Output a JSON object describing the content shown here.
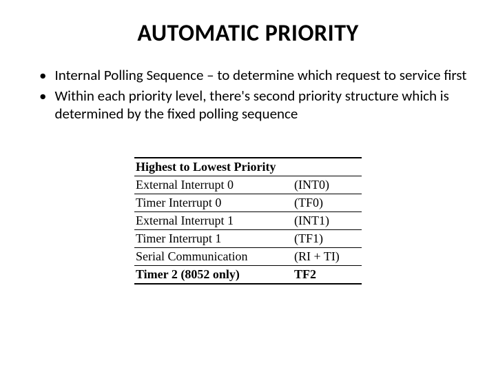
{
  "title": "AUTOMATIC PRIORITY",
  "bullets": [
    "Internal Polling Sequence – to determine which request to service first",
    "Within each priority level, there's second priority structure which is determined by the fixed polling sequence"
  ],
  "table": {
    "header": "Highest to Lowest Priority",
    "rows": [
      {
        "name": "External Interrupt 0",
        "code": "(INT0)"
      },
      {
        "name": "Timer Interrupt 0",
        "code": "(TF0)"
      },
      {
        "name": "External Interrupt 1",
        "code": "(INT1)"
      },
      {
        "name": "Timer Interrupt 1",
        "code": "(TF1)"
      },
      {
        "name": "Serial Communication",
        "code": "(RI + TI)"
      },
      {
        "name": "Timer 2 (8052 only)",
        "code": "TF2"
      }
    ]
  }
}
